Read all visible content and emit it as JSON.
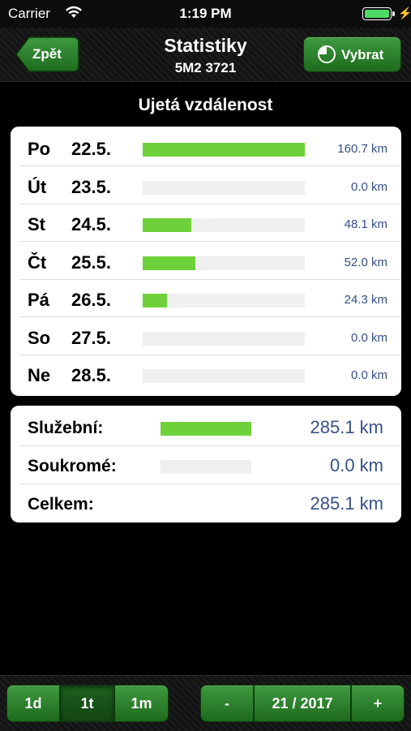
{
  "status_bar": {
    "carrier": "Carrier",
    "time": "1:19 PM"
  },
  "nav": {
    "back_label": "Zpět",
    "title": "Statistiky",
    "subtitle": "5M2 3721",
    "select_label": "Vybrat"
  },
  "section_title": "Ujetá vzdálenost",
  "days": [
    {
      "name": "Po",
      "date": "22.5.",
      "value": "160.7 km",
      "fraction": 1.0
    },
    {
      "name": "Út",
      "date": "23.5.",
      "value": "0.0 km",
      "fraction": 0.0
    },
    {
      "name": "St",
      "date": "24.5.",
      "value": "48.1 km",
      "fraction": 0.299
    },
    {
      "name": "Čt",
      "date": "25.5.",
      "value": "52.0 km",
      "fraction": 0.324
    },
    {
      "name": "Pá",
      "date": "26.5.",
      "value": "24.3 km",
      "fraction": 0.151
    },
    {
      "name": "So",
      "date": "27.5.",
      "value": "0.0 km",
      "fraction": 0.0
    },
    {
      "name": "Ne",
      "date": "28.5.",
      "value": "0.0 km",
      "fraction": 0.0
    }
  ],
  "summary": [
    {
      "label": "Služební:",
      "value": "285.1 km",
      "fraction": 1.0,
      "has_bar": true
    },
    {
      "label": "Soukromé:",
      "value": "0.0 km",
      "fraction": 0.0,
      "has_bar": true
    },
    {
      "label": "Celkem:",
      "value": "285.1 km",
      "has_bar": false
    }
  ],
  "toolbar": {
    "period_options": [
      "1d",
      "1t",
      "1m"
    ],
    "selected_period": "1t",
    "prev_label": "-",
    "week_label": "21 / 2017",
    "next_label": "+"
  },
  "colors": {
    "bar": "#6fd13a",
    "value_text": "#35508a",
    "button_green": "#2e7d2e"
  }
}
